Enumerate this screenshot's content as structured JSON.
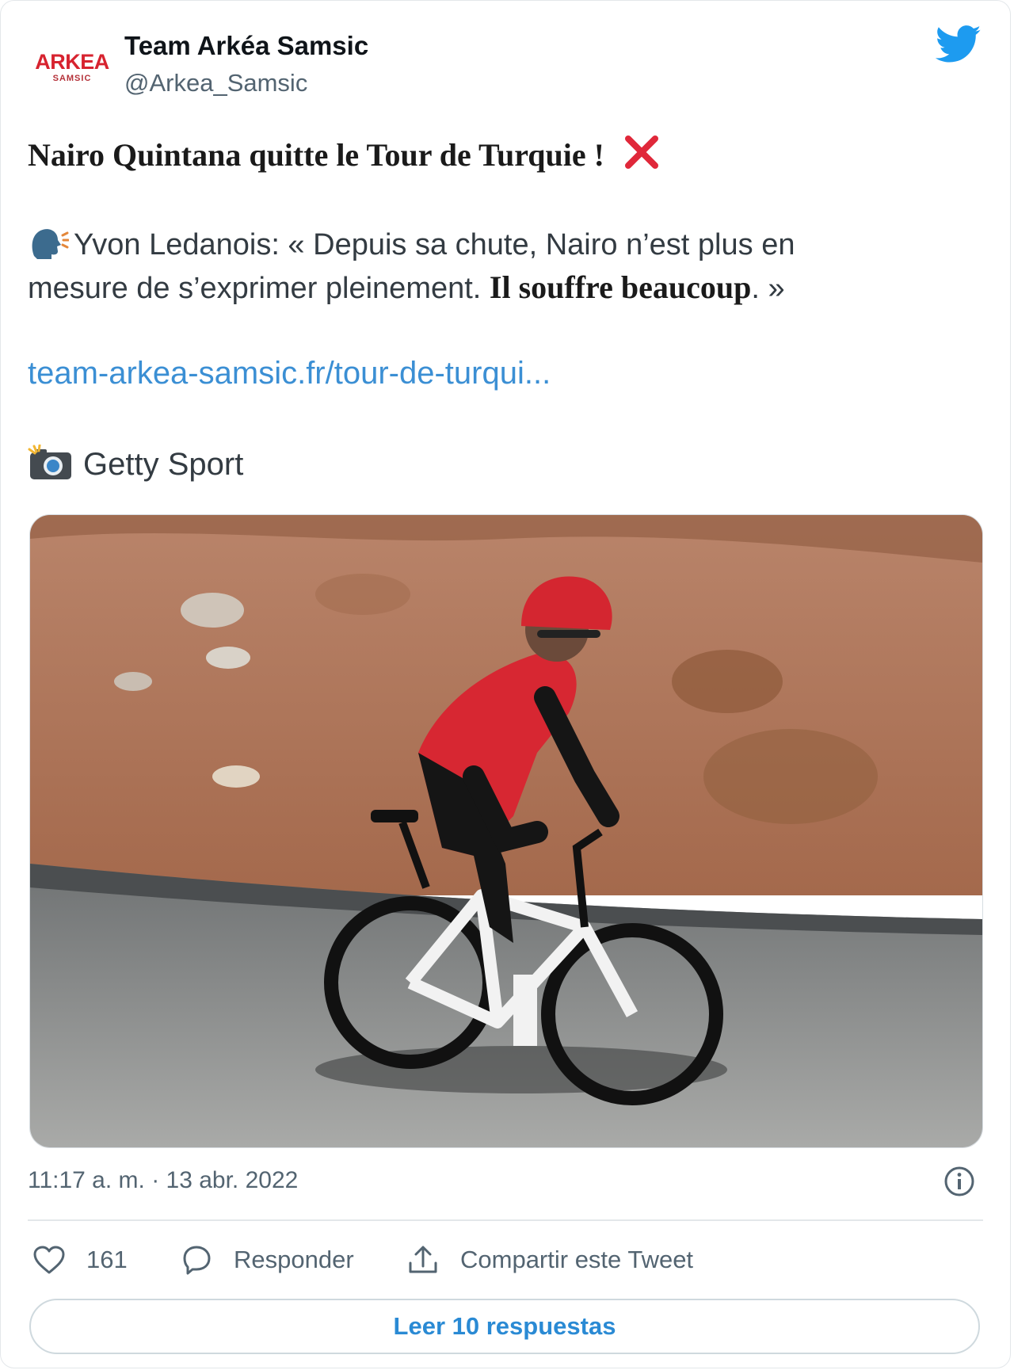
{
  "account": {
    "name": "Team Arkéa Samsic",
    "handle": "@Arkea_Samsic",
    "avatar_logo_top": "ARKEA",
    "avatar_logo_bottom": "SAMSIC"
  },
  "tweet": {
    "title": "Nairo Quintana quitte le Tour de Turquie !",
    "quote_line1": "Yvon Ledanois: « Depuis sa chute, Nairo n’est plus en",
    "quote_line2_regular": "mesure de s’exprimer pleinement.",
    "quote_line2_bold": "Il souffre beaucoup",
    "quote_line2_end": ". »",
    "link_text": "team-arkea-samsic.fr/tour-de-turqui...",
    "photo_credit": "Getty Sport",
    "timestamp": "11:17 a. m. · 13 abr. 2022"
  },
  "icons": {
    "brand": "twitter-bird-icon",
    "title_mark": "red-x-mark-icon",
    "speaking": "speaking-head-icon",
    "camera": "camera-flash-icon",
    "info": "info-icon",
    "like": "heart-icon",
    "reply": "speech-bubble-icon",
    "share": "share-upload-icon"
  },
  "actions": {
    "like_count": "161",
    "reply_label": "Responder",
    "share_label": "Compartir este Tweet",
    "read_replies_label": "Leer 10 respuestas"
  },
  "colors": {
    "twitter_blue": "#1d9bf0",
    "link_blue": "#3b8fd4",
    "x_red": "#e0283a",
    "muted": "#536471"
  }
}
